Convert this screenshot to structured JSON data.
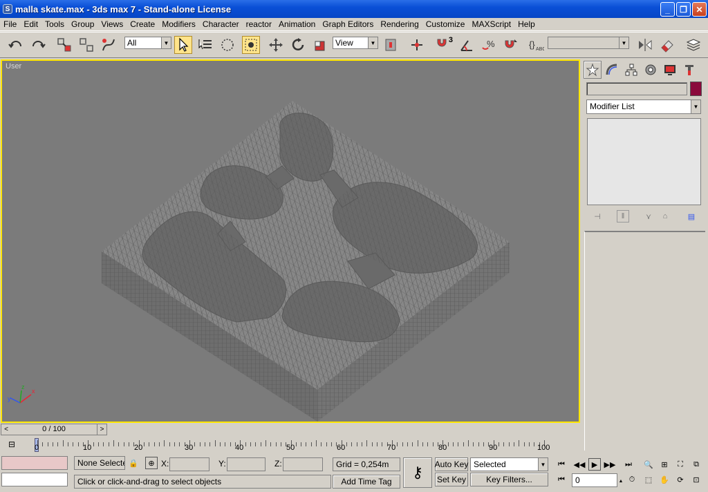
{
  "window": {
    "title": "malla skate.max - 3ds max 7  - Stand-alone License",
    "app_icon": "S"
  },
  "menu": [
    "File",
    "Edit",
    "Tools",
    "Group",
    "Views",
    "Create",
    "Modifiers",
    "Character",
    "reactor",
    "Animation",
    "Graph Editors",
    "Rendering",
    "Customize",
    "MAXScript",
    "Help"
  ],
  "toolbar": {
    "selection_filter": "All",
    "ref_coord": "View",
    "snap_label": "3",
    "named_selection": ""
  },
  "viewport": {
    "label": "User",
    "axis_x": "x",
    "axis_y": "y",
    "axis_z": "z"
  },
  "command_panel": {
    "object_name": "",
    "modifier_list": "Modifier List",
    "object_color": "#8a0a3c"
  },
  "time": {
    "slider": "0 / 100",
    "ticks": [
      "0",
      "10",
      "20",
      "30",
      "40",
      "50",
      "60",
      "70",
      "80",
      "90",
      "100"
    ],
    "current_frame": "0"
  },
  "status": {
    "selection": "None Selecte",
    "x_label": "X:",
    "y_label": "Y:",
    "z_label": "Z:",
    "x_value": "",
    "y_value": "",
    "z_value": "",
    "grid": "Grid = 0,254m",
    "prompt": "Click or click-and-drag to select objects",
    "add_time_tag": "Add Time Tag",
    "auto_key": "Auto Key",
    "set_key": "Set Key",
    "key_mode": "Selected",
    "key_filters": "Key Filters..."
  },
  "colors": {
    "viewport_border": "#ffe600",
    "viewport_bg": "#7b7b7b",
    "title_bar": "#0a4fd6"
  }
}
